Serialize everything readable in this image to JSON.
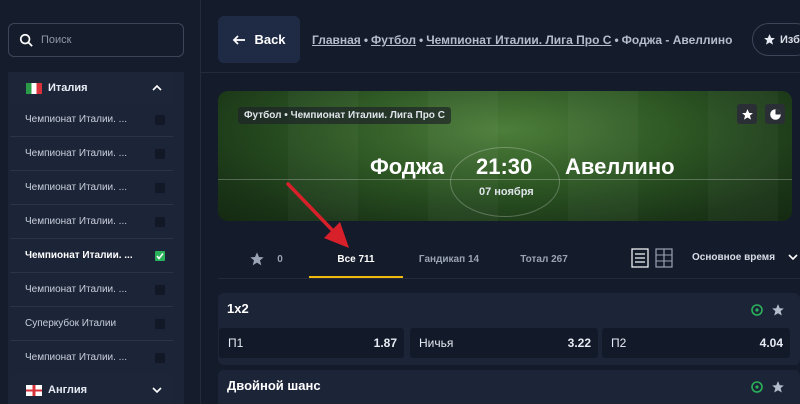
{
  "search": {
    "placeholder": "Поиск"
  },
  "sidebar": {
    "country_top": "Италия",
    "leagues": [
      {
        "label": "Чемпионат Италии. ...",
        "checked": false,
        "active": false
      },
      {
        "label": "Чемпионат Италии. ...",
        "checked": false,
        "active": false
      },
      {
        "label": "Чемпионат Италии. ...",
        "checked": false,
        "active": false
      },
      {
        "label": "Чемпионат Италии. ...",
        "checked": false,
        "active": false
      },
      {
        "label": "Чемпионат Италии. ...",
        "checked": true,
        "active": true
      },
      {
        "label": "Чемпионат Италии. ...",
        "checked": false,
        "active": false
      },
      {
        "label": "Суперкубок Италии",
        "checked": false,
        "active": false
      },
      {
        "label": "Чемпионат Италии. ...",
        "checked": false,
        "active": false
      }
    ],
    "country_bottom": "Англия"
  },
  "header": {
    "back_label": "Back",
    "breadcrumb": {
      "home": "Главная",
      "sport": "Футбол",
      "league": "Чемпионат Италии. Лига Про С",
      "current": "Фоджа - Авеллино",
      "separator": "•"
    },
    "favorites_label": "Избр"
  },
  "match": {
    "competition": "Футбол • Чемпионат Италии. Лига Про С",
    "home_team": "Фоджа",
    "away_team": "Авеллино",
    "time": "21:30",
    "date": "07 ноября"
  },
  "tabs": {
    "favorites_count": "0",
    "all": "Все 711",
    "handicap": "Гандикап 14",
    "total": "Тотал 267",
    "period": "Основное время"
  },
  "markets": [
    {
      "title": "1x2",
      "odds": [
        {
          "label": "П1",
          "value": "1.87"
        },
        {
          "label": "Ничья",
          "value": "3.22"
        },
        {
          "label": "П2",
          "value": "4.04"
        }
      ]
    },
    {
      "title": "Двойной шанс"
    }
  ],
  "colors": {
    "accent": "#f0b90b",
    "annotation_arrow": "#d8202a",
    "check": "#2ab25a",
    "background": "#141b2b"
  }
}
